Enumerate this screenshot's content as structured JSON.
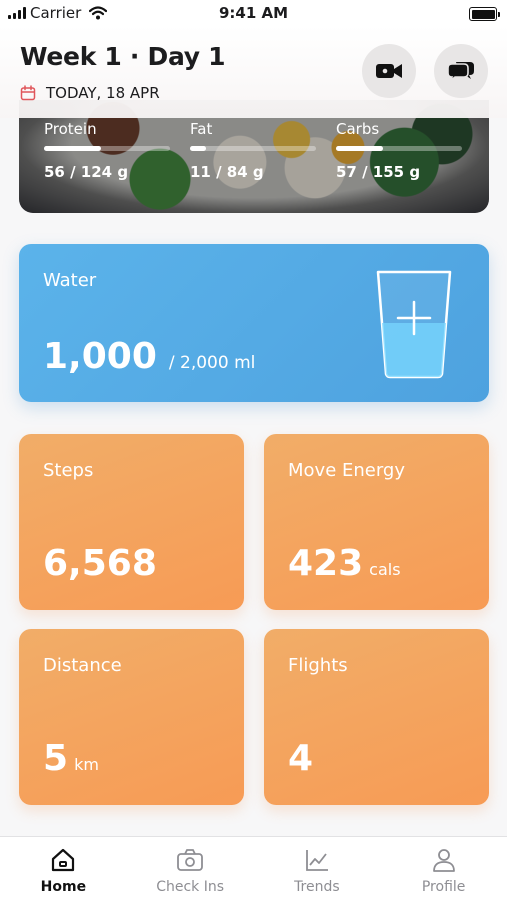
{
  "status_bar": {
    "carrier": "Carrier",
    "time": "9:41 AM"
  },
  "header": {
    "title": "Week 1 · Day 1",
    "date": "TODAY, 18 APR"
  },
  "meal": {
    "macros": [
      {
        "label": "Protein",
        "value": "56 / 124 g",
        "progress": 0.45
      },
      {
        "label": "Fat",
        "value": "11 / 84 g",
        "progress": 0.13
      },
      {
        "label": "Carbs",
        "value": "57 / 155 g",
        "progress": 0.37
      }
    ]
  },
  "water": {
    "label": "Water",
    "amount": "1,000",
    "goal": "/ 2,000 ml",
    "progress": 0.5
  },
  "tiles": {
    "steps": {
      "label": "Steps",
      "value": "6,568",
      "unit": ""
    },
    "move": {
      "label": "Move Energy",
      "value": "423",
      "unit": "cals"
    },
    "distance": {
      "label": "Distance",
      "value": "5",
      "unit": "km"
    },
    "flights": {
      "label": "Flights",
      "value": "4",
      "unit": ""
    }
  },
  "tabbar": {
    "tabs": [
      {
        "label": "Home",
        "icon": "home-icon",
        "active": true
      },
      {
        "label": "Check Ins",
        "icon": "camera-icon",
        "active": false
      },
      {
        "label": "Trends",
        "icon": "trends-icon",
        "active": false
      },
      {
        "label": "Profile",
        "icon": "profile-icon",
        "active": false
      }
    ]
  },
  "colors": {
    "water": "#4ea2df",
    "tile": "#f5a45e",
    "calendar_accent": "#e0565b"
  }
}
